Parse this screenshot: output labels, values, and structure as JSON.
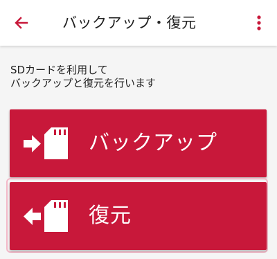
{
  "colors": {
    "accent": "#c8183a",
    "background": "#f5f5f5",
    "app_bar": "#ffffff",
    "focus_outline": "#f3b8c8"
  },
  "header": {
    "back_icon": "arrow-left-icon",
    "title": "バックアップ・復元",
    "menu_icon": "more-vertical-icon"
  },
  "description": {
    "line1": "SDカードを利用して",
    "line2": "バックアップと復元を行います"
  },
  "buttons": {
    "backup": {
      "label": "バックアップ",
      "icon": "arrow-into-sd-card-icon"
    },
    "restore": {
      "label": "復元",
      "icon": "arrow-out-of-sd-card-icon"
    }
  }
}
